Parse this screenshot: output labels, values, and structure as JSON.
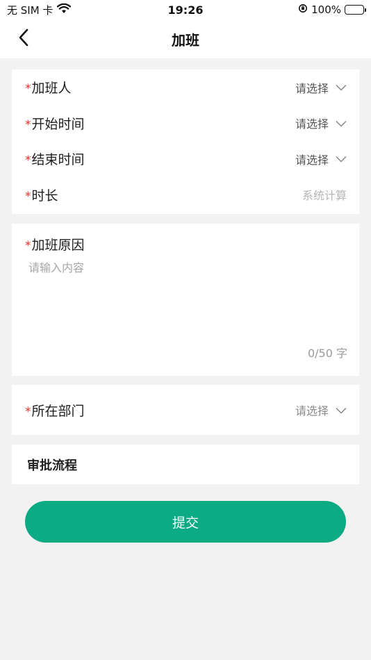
{
  "status_bar": {
    "carrier": "无 SIM 卡",
    "time": "19:26",
    "battery": "100%"
  },
  "nav": {
    "title": "加班",
    "back_icon": "chevron-left-icon"
  },
  "form": {
    "required_mark": "*",
    "fields": [
      {
        "label": "加班人",
        "value": "请选择",
        "icon": "chevron-down-icon"
      },
      {
        "label": "开始时间",
        "value": "请选择",
        "icon": "chevron-down-icon"
      },
      {
        "label": "结束时间",
        "value": "请选择",
        "icon": "chevron-down-icon"
      },
      {
        "label": "时长",
        "value": "系统计算"
      }
    ],
    "reason": {
      "label": "加班原因",
      "placeholder": "请输入内容",
      "counter": "0/50 字"
    },
    "department": {
      "label": "所在部门",
      "value": "请选择",
      "icon": "chevron-down-icon"
    },
    "approval": {
      "title": "审批流程"
    }
  },
  "submit_label": "提交",
  "colors": {
    "accent": "#0dab84",
    "required": "#e0322d",
    "background": "#f2f2f2"
  }
}
